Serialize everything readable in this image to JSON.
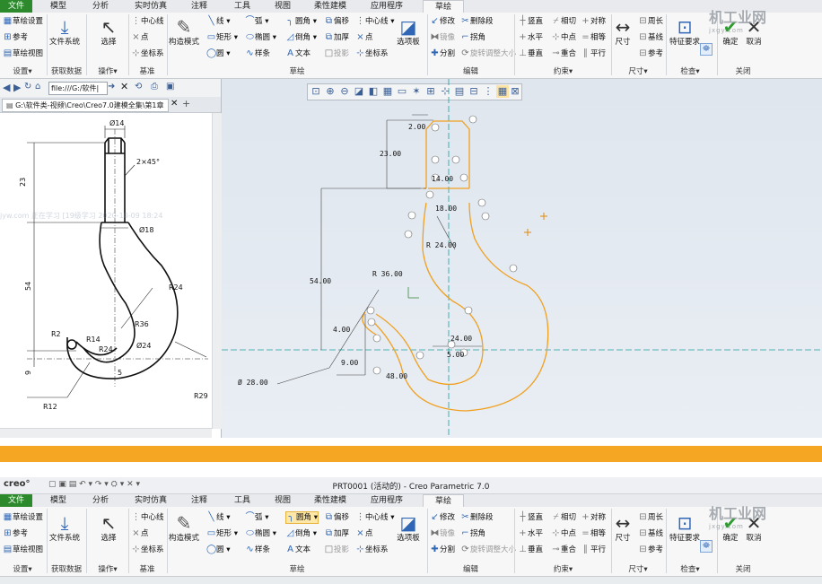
{
  "ribbon": {
    "tabs": [
      "文件",
      "模型",
      "分析",
      "实时仿真",
      "注释",
      "工具",
      "视图",
      "柔性建模",
      "应用程序",
      "草绘"
    ],
    "settings": {
      "items": [
        "草绘设置",
        "参考",
        "草绘视图"
      ],
      "group": "设置"
    },
    "data": {
      "label": "文件系统",
      "group": "获取数据"
    },
    "ops": {
      "label": "选择",
      "group": "操作"
    },
    "datum": {
      "items": [
        "中心线",
        "点",
        "坐标系"
      ],
      "group": "基准"
    },
    "sketch": {
      "construct": "构造模式",
      "col1": [
        "线",
        "矩形",
        "圆"
      ],
      "col2": [
        "弧",
        "椭圆",
        "样条"
      ],
      "col3": [
        "圆角",
        "倒角",
        "文本"
      ],
      "col4": [
        "偏移",
        "加厚",
        "投影"
      ],
      "col5": [
        "中心线",
        "点",
        "坐标系"
      ],
      "palette": "选项板",
      "group": "草绘"
    },
    "edit": {
      "items": [
        "修改",
        "删除段",
        "镜像",
        "拐角",
        "分割",
        "旋转调整大小"
      ],
      "group": "编辑"
    },
    "constrain": {
      "items": [
        "竖直",
        "相切",
        "对称",
        "水平",
        "中点",
        "相等",
        "垂直",
        "重合",
        "平行"
      ],
      "group": "约束"
    },
    "dimension": {
      "label": "尺寸",
      "items": [
        "周长",
        "基线",
        "参考"
      ],
      "group": "尺寸"
    },
    "inspect": {
      "label": "特征要求",
      "group": "检查"
    },
    "close": {
      "items": [
        "确定",
        "取消"
      ],
      "group": "关闭"
    }
  },
  "browser": {
    "url": "file:///G:/软件|",
    "tab": "G:\\软件类-视频\\Creo\\Creo7.0建模全集\\第1章",
    "overlay": "jyw.com  正在学习  [19级学习  2020-10-09 18:24"
  },
  "drawing": {
    "dims": [
      "Ø14",
      "2×45°",
      "Ø18",
      "R24",
      "23",
      "R36",
      "54",
      "R2",
      "R14",
      "R24",
      "Ø24",
      "9",
      "5",
      "R29",
      "R12"
    ]
  },
  "sketch": {
    "dims": [
      "2.00",
      "23.00",
      "14.00",
      "18.00",
      "R 24.00",
      "R 36.00",
      "54.00",
      "4.00",
      "9.00",
      "Ø 28.00",
      "48.00",
      "24.00",
      "5.00"
    ]
  },
  "window2": {
    "logo": "creo°",
    "title": "PRT0001 (活动的) - Creo Parametric 7.0"
  },
  "watermark": {
    "brand": "机工业网",
    "url": "jxgy.com"
  }
}
